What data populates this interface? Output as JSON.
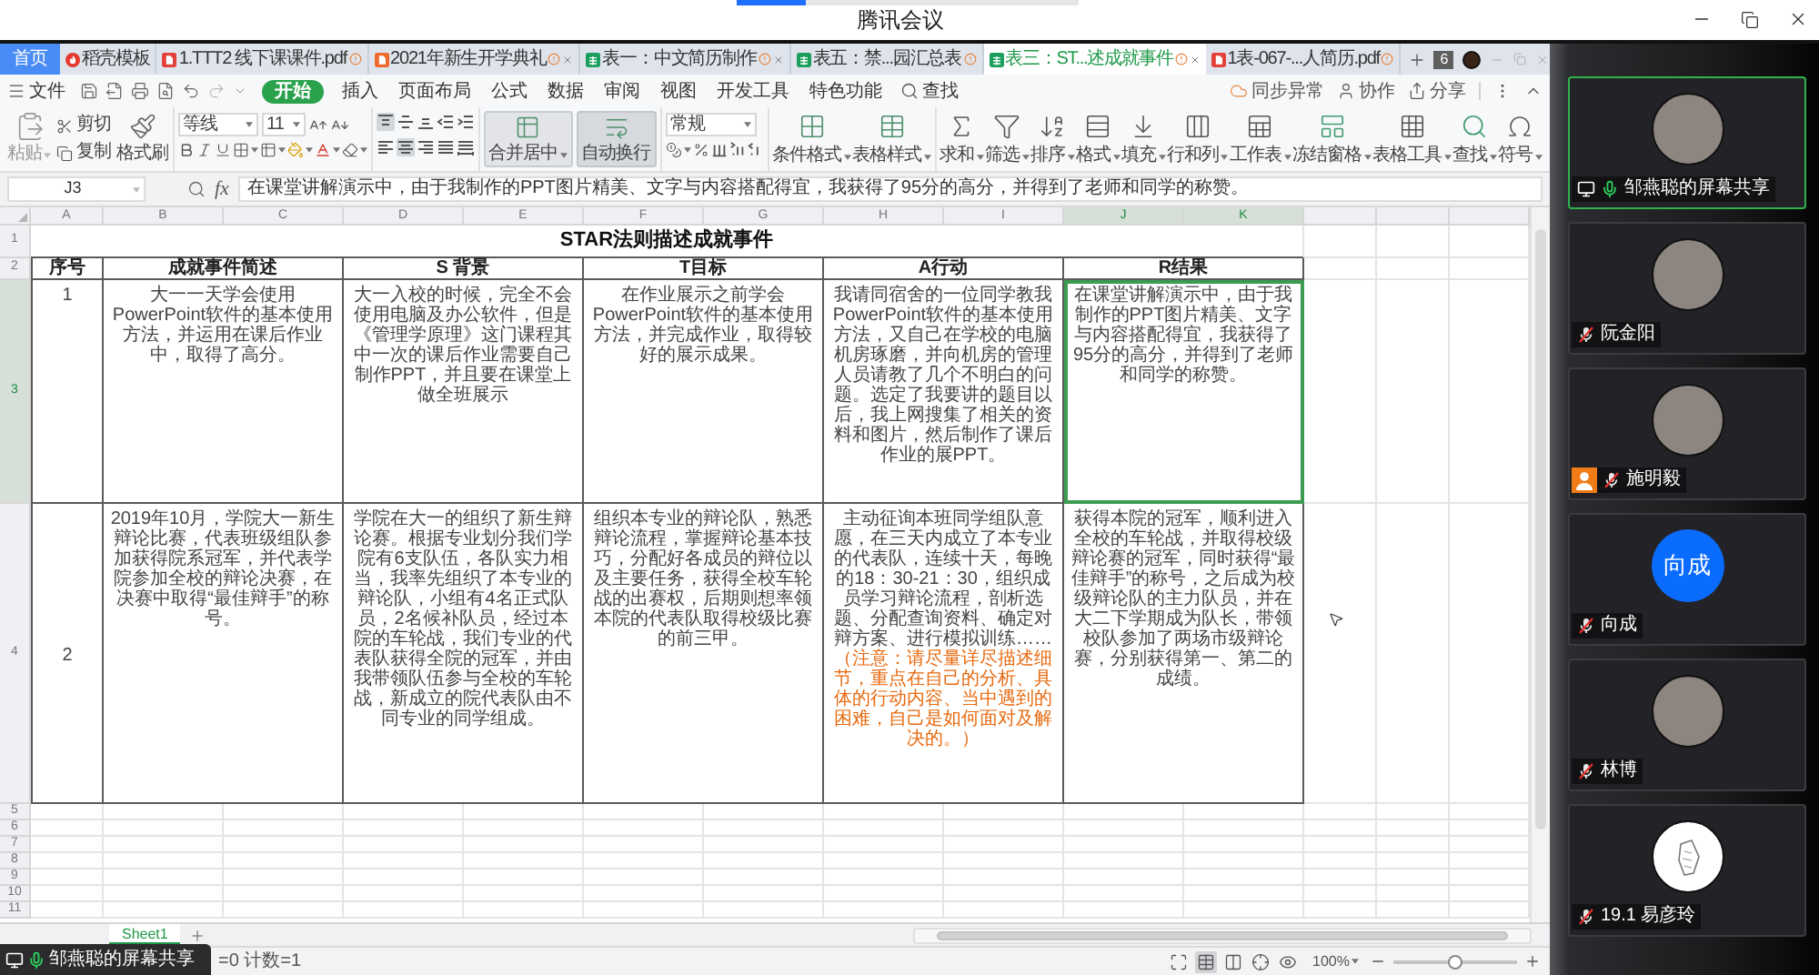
{
  "meeting": {
    "title": "腾讯会议"
  },
  "wps": {
    "tabs": [
      {
        "kind": "home",
        "label": "首页",
        "selected": false,
        "warning": false,
        "closable": false
      },
      {
        "kind": "docer",
        "label": "稻壳模板",
        "selected": false,
        "warning": false,
        "closable": false
      },
      {
        "kind": "pdf",
        "label": "1.TTT2 线下课课件.pdf",
        "selected": false,
        "warning": true,
        "closable": false
      },
      {
        "kind": "ppt",
        "label": "2021年新生开学典礼",
        "selected": false,
        "warning": true,
        "closable": true
      },
      {
        "kind": "sheet",
        "label": "表一：中文简历制作",
        "selected": false,
        "warning": true,
        "closable": true
      },
      {
        "kind": "sheet",
        "label": "表五：禁...园汇总表",
        "selected": false,
        "warning": true,
        "closable": false
      },
      {
        "kind": "sheet",
        "label": "表三：ST...述成就事件",
        "selected": true,
        "warning": true,
        "closable": true
      },
      {
        "kind": "pdf",
        "label": "1表-067-...人简历.pdf",
        "selected": false,
        "warning": true,
        "closable": false
      }
    ],
    "window_count": "6",
    "menu": {
      "file": "文件",
      "tabs": [
        {
          "label": "开始",
          "selected": true
        },
        {
          "label": "插入",
          "selected": false
        },
        {
          "label": "页面布局",
          "selected": false
        },
        {
          "label": "公式",
          "selected": false
        },
        {
          "label": "数据",
          "selected": false
        },
        {
          "label": "审阅",
          "selected": false
        },
        {
          "label": "视图",
          "selected": false
        },
        {
          "label": "开发工具",
          "selected": false
        },
        {
          "label": "特色功能",
          "selected": false
        }
      ],
      "search": "查找",
      "actions": [
        {
          "kind": "sync",
          "label": "同步异常"
        },
        {
          "kind": "collab",
          "label": "协作"
        },
        {
          "kind": "share",
          "label": "分享"
        }
      ]
    },
    "ribbon": {
      "paste": "粘贴",
      "cut": "剪切",
      "copy": "复制",
      "format_painter": "格式刷",
      "font": "等线",
      "font_size": "11",
      "vertical_align": [
        {
          "kind": "top",
          "selected": true
        },
        {
          "kind": "middle",
          "selected": false
        },
        {
          "kind": "bottom",
          "selected": false
        }
      ],
      "horizontal_align": [
        {
          "kind": "left",
          "selected": false
        },
        {
          "kind": "center",
          "selected": true
        },
        {
          "kind": "right",
          "selected": false
        },
        {
          "kind": "justify",
          "selected": false
        },
        {
          "kind": "distributed",
          "selected": false
        }
      ],
      "merge": {
        "label": "合并居中",
        "pressed": true
      },
      "wrap": {
        "label": "自动换行",
        "pressed": true
      },
      "number_format": "常规",
      "tools": [
        {
          "kind": "conditional",
          "label": "条件格式"
        },
        {
          "kind": "style",
          "label": "表格样式"
        },
        {
          "kind": "sum",
          "label": "求和"
        },
        {
          "kind": "filter",
          "label": "筛选"
        },
        {
          "kind": "sort",
          "label": "排序"
        },
        {
          "kind": "format",
          "label": "格式"
        },
        {
          "kind": "fill",
          "label": "填充"
        },
        {
          "kind": "rowcol",
          "label": "行和列"
        },
        {
          "kind": "sheet",
          "label": "工作表"
        },
        {
          "kind": "freeze",
          "label": "冻结窗格"
        },
        {
          "kind": "tools",
          "label": "表格工具"
        },
        {
          "kind": "find",
          "label": "查找"
        },
        {
          "kind": "symbol",
          "label": "符号"
        }
      ]
    },
    "formula_bar": {
      "cell": "J3",
      "fx": "fx",
      "value": "在课堂讲解演示中，由于我制作的PPT图片精美、文字与内容搭配得宜，我获得了95分的高分，并得到了老师和同学的称赞。"
    },
    "sheet": {
      "column_letters": [
        {
          "label": "A",
          "selected": false
        },
        {
          "label": "B",
          "selected": false
        },
        {
          "label": "C",
          "selected": false
        },
        {
          "label": "D",
          "selected": false
        },
        {
          "label": "E",
          "selected": false
        },
        {
          "label": "F",
          "selected": false
        },
        {
          "label": "G",
          "selected": false
        },
        {
          "label": "H",
          "selected": false
        },
        {
          "label": "I",
          "selected": false
        },
        {
          "label": "J",
          "selected": true
        },
        {
          "label": "K",
          "selected": true
        }
      ],
      "row_numbers": [
        {
          "label": "1",
          "selected": false
        },
        {
          "label": "2",
          "selected": false
        },
        {
          "label": "3",
          "selected": true
        },
        {
          "label": "4",
          "selected": false
        },
        {
          "label": "5",
          "selected": false
        },
        {
          "label": "6",
          "selected": false
        },
        {
          "label": "7",
          "selected": false
        },
        {
          "label": "8",
          "selected": false
        },
        {
          "label": "9",
          "selected": false
        },
        {
          "label": "10",
          "selected": false
        },
        {
          "label": "11",
          "selected": false
        }
      ],
      "title": "STAR法则描述成就事件",
      "header": [
        "序号",
        "成就事件简述",
        "S 背景",
        "T目标",
        "A行动",
        "R结果"
      ],
      "rows": [
        {
          "cells": [
            {
              "text": "1",
              "selected": false
            },
            {
              "text": "大一一天学会使用PowerPoint软件的基本使用方法，并运用在课后作业中，取得了高分。",
              "selected": false
            },
            {
              "text": "大一入校的时候，完全不会使用电脑及办公软件，但是《管理学原理》这门课程其中一次的课后作业需要自己制作PPT，并且要在课堂上做全班展示",
              "selected": false
            },
            {
              "text": "在作业展示之前学会PowerPoint软件的基本使用方法，并完成作业，取得较好的展示成果。",
              "selected": false
            },
            {
              "text": "我请同宿舍的一位同学教我PowerPoint软件的基本使用方法，又自己在学校的电脑机房琢磨，并向机房的管理人员请教了几个不明白的问题。选定了我要讲的题目以后，我上网搜集了相关的资料和图片，然后制作了课后作业的展PPT。",
              "selected": false
            },
            {
              "text": "在课堂讲解演示中，由于我制作的PPT图片精美、文字与内容搭配得宜，我获得了95分的高分，并得到了老师和同学的称赞。",
              "selected": true
            }
          ]
        },
        {
          "cells": [
            {
              "text": "2",
              "selected": false
            },
            {
              "text": "2019年10月，学院大一新生辩论比赛，代表班级组队参加获得院系冠军，并代表学院参加全校的辩论决赛，在决赛中取得“最佳辩手”的称号。",
              "selected": false
            },
            {
              "text": "学院在大一的组织了新生辩论赛。根据专业划分我们学院有6支队伍，各队实力相当，我率先组织了本专业的辩论队，小组有4名正式队员，2名候补队员，经过本院的车轮战，我们专业的代表队获得全院的冠军，并由我带领队伍参与全校的车轮战，新成立的院代表队由不同专业的同学组成。",
              "selected": false
            },
            {
              "text": "组织本专业的辩论队，熟悉辩论流程，掌握辩论基本技巧，分配好各成员的辩位以及主要任务，获得全校车轮战的出赛权，后期则想率领本院的代表队取得校级比赛的前三甲。",
              "selected": false
            },
            {
              "text": "主动征询本班同学组队意愿，在三天内成立了本专业的代表队，连续十天，每晚的18：30-21：30，组织成员学习辩论流程，剖析选题、分配查询资料、确定对辩方案、进行模拟训练……",
              "note": "（注意：请尽量详尽描述细节，重点在自己的分析、具体的行动内容、当中遇到的困难，自己是如何面对及解决的。）",
              "selected": false
            },
            {
              "text": "获得本院的冠军，顺利进入全校的车轮战，并取得校级辩论赛的冠军，同时获得“最佳辩手”的称号，之后成为校级辩论队的主力队员，并在大二下学期成为队长，带领校队参加了两场市级辩论赛，分别获得第一、第二的成绩。",
              "selected": false
            }
          ]
        }
      ],
      "tabs": [
        {
          "label": "Sheet1",
          "selected": true
        }
      ]
    },
    "status_bar": {
      "summary": "=0 计数=1",
      "views": [
        {
          "kind": "fullscreen",
          "selected": false
        },
        {
          "kind": "normal",
          "selected": true
        },
        {
          "kind": "page",
          "selected": false
        },
        {
          "kind": "reading",
          "selected": false
        },
        {
          "kind": "eye",
          "selected": false
        }
      ],
      "zoom": {
        "reading": "100%",
        "level": 0.5
      }
    }
  },
  "share_banner": {
    "label": "邹燕聪的屏幕共享"
  },
  "participants": [
    {
      "name": "邹燕聪的屏幕共享",
      "avatar": {
        "kind": "photo"
      },
      "sharing": true,
      "host": false,
      "muted": false,
      "active": true
    },
    {
      "name": "阮金阳",
      "avatar": {
        "kind": "photo"
      },
      "sharing": false,
      "host": false,
      "muted": true,
      "active": false
    },
    {
      "name": "施明毅",
      "avatar": {
        "kind": "photo"
      },
      "sharing": false,
      "host": true,
      "muted": true,
      "active": false
    },
    {
      "name": "向成",
      "avatar": {
        "kind": "initials",
        "text": "向成"
      },
      "sharing": false,
      "host": false,
      "muted": true,
      "active": false
    },
    {
      "name": "林博",
      "avatar": {
        "kind": "photo"
      },
      "sharing": false,
      "host": false,
      "muted": true,
      "active": false
    },
    {
      "name": "19.1 易彦玲",
      "avatar": {
        "kind": "sketch"
      },
      "sharing": false,
      "host": false,
      "muted": true,
      "active": false
    }
  ]
}
